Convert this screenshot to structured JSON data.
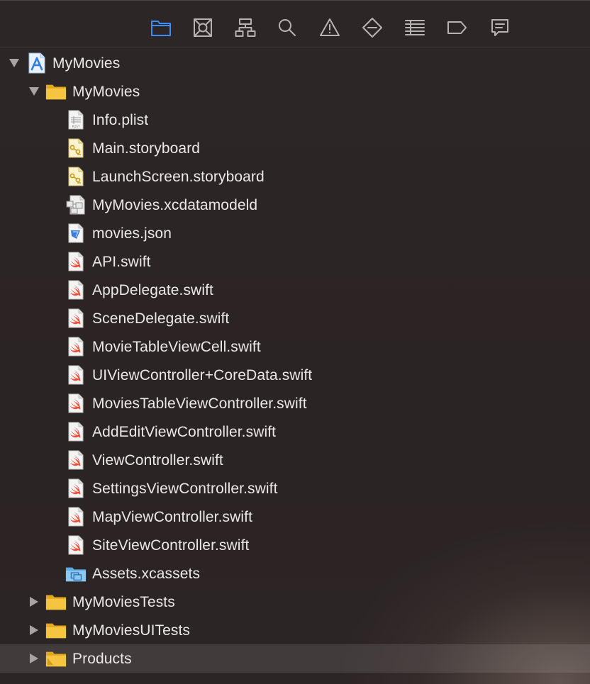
{
  "toolbar": {
    "items": [
      {
        "name": "project-navigator-icon",
        "active": true
      },
      {
        "name": "source-control-navigator-icon",
        "active": false
      },
      {
        "name": "symbol-navigator-icon",
        "active": false
      },
      {
        "name": "find-navigator-icon",
        "active": false
      },
      {
        "name": "issue-navigator-icon",
        "active": false
      },
      {
        "name": "test-navigator-icon",
        "active": false
      },
      {
        "name": "debug-navigator-icon",
        "active": false
      },
      {
        "name": "breakpoint-navigator-icon",
        "active": false
      },
      {
        "name": "report-navigator-icon",
        "active": false
      }
    ],
    "active_color": "#3d8df5",
    "inactive_color": "#b8b3b3"
  },
  "tree": {
    "rows": [
      {
        "label": "MyMovies",
        "type": "project",
        "depth": 0,
        "disclosure": "expanded",
        "icon": "xcode-project-icon"
      },
      {
        "label": "MyMovies",
        "type": "folder",
        "depth": 1,
        "disclosure": "expanded",
        "icon": "folder-icon"
      },
      {
        "label": "Info.plist",
        "type": "file",
        "depth": 2,
        "icon": "plist-file-icon"
      },
      {
        "label": "Main.storyboard",
        "type": "file",
        "depth": 2,
        "icon": "storyboard-file-icon"
      },
      {
        "label": "LaunchScreen.storyboard",
        "type": "file",
        "depth": 2,
        "icon": "storyboard-file-icon"
      },
      {
        "label": "MyMovies.xcdatamodeld",
        "type": "file",
        "depth": 2,
        "icon": "data-model-file-icon"
      },
      {
        "label": "movies.json",
        "type": "file",
        "depth": 2,
        "icon": "json-file-icon"
      },
      {
        "label": "API.swift",
        "type": "file",
        "depth": 2,
        "icon": "swift-file-icon"
      },
      {
        "label": "AppDelegate.swift",
        "type": "file",
        "depth": 2,
        "icon": "swift-file-icon"
      },
      {
        "label": "SceneDelegate.swift",
        "type": "file",
        "depth": 2,
        "icon": "swift-file-icon"
      },
      {
        "label": "MovieTableViewCell.swift",
        "type": "file",
        "depth": 2,
        "icon": "swift-file-icon"
      },
      {
        "label": "UIViewController+CoreData.swift",
        "type": "file",
        "depth": 2,
        "icon": "swift-file-icon"
      },
      {
        "label": "MoviesTableViewController.swift",
        "type": "file",
        "depth": 2,
        "icon": "swift-file-icon"
      },
      {
        "label": "AddEditViewController.swift",
        "type": "file",
        "depth": 2,
        "icon": "swift-file-icon"
      },
      {
        "label": "ViewController.swift",
        "type": "file",
        "depth": 2,
        "icon": "swift-file-icon"
      },
      {
        "label": "SettingsViewController.swift",
        "type": "file",
        "depth": 2,
        "icon": "swift-file-icon"
      },
      {
        "label": "MapViewController.swift",
        "type": "file",
        "depth": 2,
        "icon": "swift-file-icon"
      },
      {
        "label": "SiteViewController.swift",
        "type": "file",
        "depth": 2,
        "icon": "swift-file-icon"
      },
      {
        "label": "Assets.xcassets",
        "type": "file",
        "depth": 2,
        "icon": "assets-catalog-icon"
      },
      {
        "label": "MyMoviesTests",
        "type": "folder",
        "depth": 1,
        "disclosure": "collapsed",
        "icon": "folder-icon"
      },
      {
        "label": "MyMoviesUITests",
        "type": "folder",
        "depth": 1,
        "disclosure": "collapsed",
        "icon": "folder-icon"
      },
      {
        "label": "Products",
        "type": "folder",
        "depth": 1,
        "disclosure": "collapsed",
        "icon": "products-folder-icon",
        "selected": true
      }
    ]
  },
  "colors": {
    "folder": "#f5c542",
    "swift": "#f05138",
    "background": "#2b2424",
    "text": "#ebe8e8"
  }
}
